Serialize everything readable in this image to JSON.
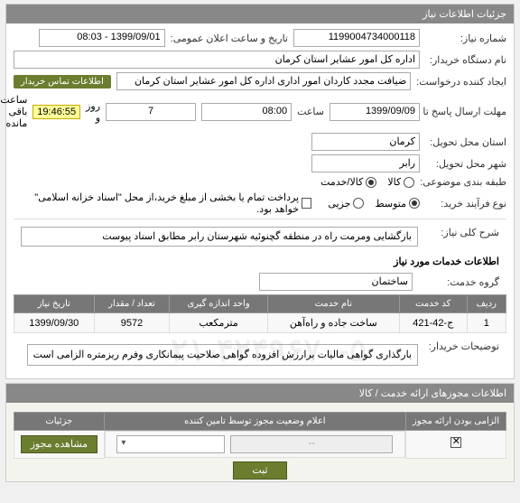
{
  "header": {
    "title": "جزئیات اطلاعات نیاز"
  },
  "info": {
    "req_no_label": "شماره نیاز:",
    "req_no": "1199004734000118",
    "pub_date_label": "تاریخ و ساعت اعلان عمومی:",
    "pub_date": "1399/09/01 - 08:03",
    "buyer_org_label": "نام دستگاه خریدار:",
    "buyer_org": "اداره کل امور عشایر استان کرمان",
    "creator_label": "ایجاد کننده درخواست:",
    "creator": "ضیافت مجدد کاردان امور اداری اداره کل امور عشایر استان کرمان",
    "contact_link": "اطلاعات تماس خریدار",
    "deadline_label": "مهلت ارسال پاسخ تا تاریخ:",
    "deadline_date": "1399/09/09",
    "time_label": "ساعت",
    "deadline_time": "08:00",
    "days_left": "7",
    "days_unit": "روز و",
    "hours_left": "19:46:55",
    "hours_unit": "ساعت باقی مانده",
    "province_label": "استان محل تحویل:",
    "province": "کرمان",
    "city_label": "شهر محل تحویل:",
    "city": "رابر",
    "category_label": "طبقه بندی موضوعی:",
    "cat_goods": "کالا",
    "cat_service": "کالا/خدمت",
    "process_label": "نوع فرآیند خرید:",
    "proc_medium": "متوسط",
    "proc_partial": "جزیی",
    "payment_note": "پرداخت تمام یا بخشی از مبلغ خرید،از محل \"اسناد خزانه اسلامی\" خواهد بود."
  },
  "main": {
    "desc_label": "شرح کلی نیاز:",
    "desc": "بازگشایی ومرمت راه در منطقه گچنوئیه شهرستان رابر مطابق اسناد پیوست",
    "service_info_title": "اطلاعات خدمات مورد نیاز",
    "service_group_label": "گروه خدمت:",
    "service_group": "ساختمان",
    "table": {
      "headers": [
        "ردیف",
        "کد خدمت",
        "نام خدمت",
        "واحد اندازه گیری",
        "تعداد / مقدار",
        "تاریخ نیاز"
      ],
      "rows": [
        {
          "idx": "1",
          "code": "ج-42-421",
          "name": "ساخت جاده و راه‌آهن",
          "unit": "مترمکعب",
          "qty": "9572",
          "date": "1399/09/30"
        }
      ]
    },
    "buyer_note_label": "توضیحات خریدار:",
    "buyer_note": "بارگذاری گواهی مالیات برارزش افزوده گواهی صلاحیت پیمانکاری وفرم ریزمتره الزامی است",
    "watermark": "۰۲۱-۴۲۴۹۶۷۰-۵"
  },
  "perm": {
    "header": "اطلاعات مجوزهای ارائه خدمت / کالا",
    "table": {
      "headers": [
        "الزامی بودن ارائه مجوز",
        "اعلام وضعیت مجوز توسط تامین کننده",
        "جزئیات"
      ],
      "mandatory_checked": true,
      "status_placeholder": "--",
      "details_btn": "مشاهده مجوز"
    },
    "save_btn": "ثبت"
  }
}
